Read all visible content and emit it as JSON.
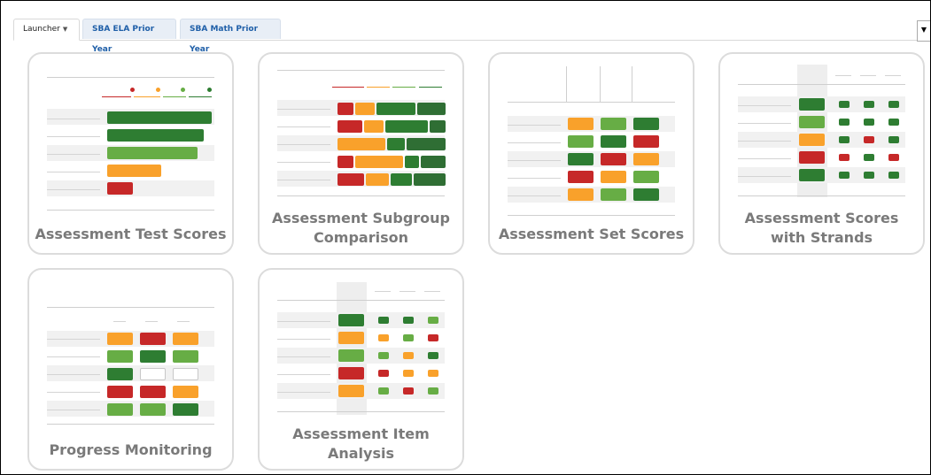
{
  "tabs": [
    {
      "label": "Launcher",
      "active": true
    },
    {
      "label": "SBA ELA Prior Year",
      "active": false
    },
    {
      "label": "SBA Math Prior Year",
      "active": false
    }
  ],
  "colors": {
    "dark_green": "#2e7d32",
    "light_green": "#67ad45",
    "orange": "#f9a12b",
    "red": "#c62828",
    "card_border": "#dcdcdc",
    "title_gray": "#7a7a7a",
    "tab_blue": "#1f5fa8"
  },
  "cards": [
    {
      "title": "Assessment Test Scores"
    },
    {
      "title": "Assessment Subgroup Comparison",
      "title_lines": [
        "Assessment Subgroup",
        "Comparison"
      ]
    },
    {
      "title": "Assessment Set Scores"
    },
    {
      "title": "Assessment Scores with Strands",
      "title_lines": [
        "Assessment Scores",
        "with Strands"
      ]
    },
    {
      "title": "Progress Monitoring"
    },
    {
      "title": "Assessment Item Analysis",
      "title_lines": [
        "Assessment Item",
        "Analysis"
      ]
    }
  ]
}
